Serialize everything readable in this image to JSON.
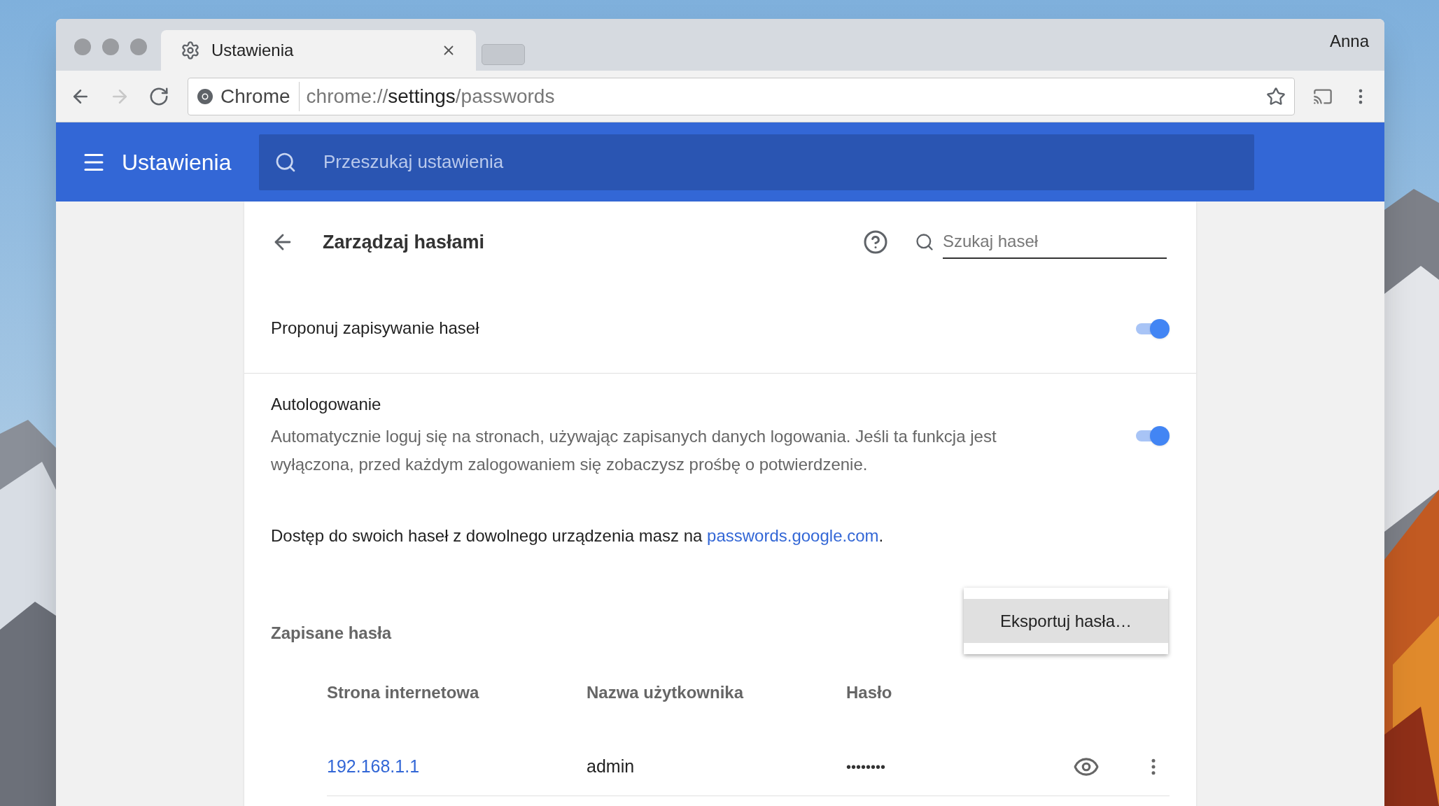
{
  "browser": {
    "tab": {
      "title": "Ustawienia",
      "selected": true
    },
    "profile": "Anna",
    "nav_buttons": [
      {
        "kind": "back",
        "disabled": false
      },
      {
        "kind": "forward",
        "disabled": true
      },
      {
        "kind": "reload",
        "disabled": false
      }
    ],
    "address": {
      "site_label": "Chrome",
      "scheme": "chrome://",
      "host": "settings",
      "path": "/passwords"
    }
  },
  "settings_header": {
    "title": "Ustawienia",
    "search_placeholder": "Przeszukaj ustawienia"
  },
  "page": {
    "title": "Zarządzaj hasłami",
    "search_placeholder": "Szukaj haseł",
    "toggles": [
      {
        "label": "Proponuj zapisywanie haseł",
        "on": true
      },
      {
        "label": "Autologowanie",
        "description": "Automatycznie loguj się na stronach, używając zapisanych danych logowania. Jeśli ta funkcja jest wyłączona, przed każdym zalogowaniem się zobaczysz prośbę o potwierdzenie.",
        "on": true
      }
    ],
    "note": {
      "text": "Dostęp do swoich haseł z dowolnego urządzenia masz na",
      "link": "passwords.google.com",
      "suffix": "."
    },
    "saved_title": "Zapisane hasła",
    "menu": [
      {
        "label": "Eksportuj hasła…",
        "selected": true
      }
    ],
    "columns": [
      "Strona internetowa",
      "Nazwa użytkownika",
      "Hasło"
    ],
    "rows": [
      {
        "site": "192.168.1.1",
        "username": "admin",
        "password": "••••••••"
      }
    ]
  }
}
